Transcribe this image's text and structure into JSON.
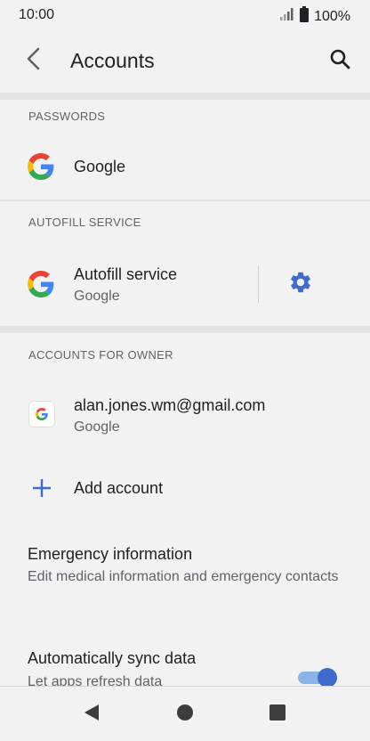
{
  "status_bar": {
    "time": "10:00",
    "battery_text": "100%"
  },
  "app_bar": {
    "title": "Accounts",
    "back_icon": "chevron-left-icon",
    "search_icon": "search-icon"
  },
  "sections": {
    "passwords": {
      "header": "PASSWORDS",
      "item": {
        "title": "Google",
        "icon": "google-logo-icon"
      }
    },
    "autofill": {
      "header": "AUTOFILL SERVICE",
      "item": {
        "title": "Autofill service",
        "subtitle": "Google",
        "icon": "google-logo-icon",
        "settings_icon": "gear-icon"
      }
    },
    "accounts": {
      "header": "ACCOUNTS FOR OWNER",
      "account": {
        "title": "alan.jones.wm@gmail.com",
        "subtitle": "Google",
        "icon": "google-logo-icon"
      },
      "add_account": {
        "title": "Add account",
        "icon": "plus-icon"
      }
    }
  },
  "emergency": {
    "title": "Emergency information",
    "subtitle": "Edit medical information and emergency contacts"
  },
  "sync": {
    "title": "Automatically sync data",
    "subtitle": "Let apps refresh data",
    "enabled": true
  },
  "nav_bar": {
    "back_icon": "triangle-back-icon",
    "home_icon": "circle-home-icon",
    "recents_icon": "square-recents-icon"
  },
  "colors": {
    "accent": "#3f6bcf",
    "background": "#f2f2f2",
    "divider": "#e3e3e3"
  }
}
